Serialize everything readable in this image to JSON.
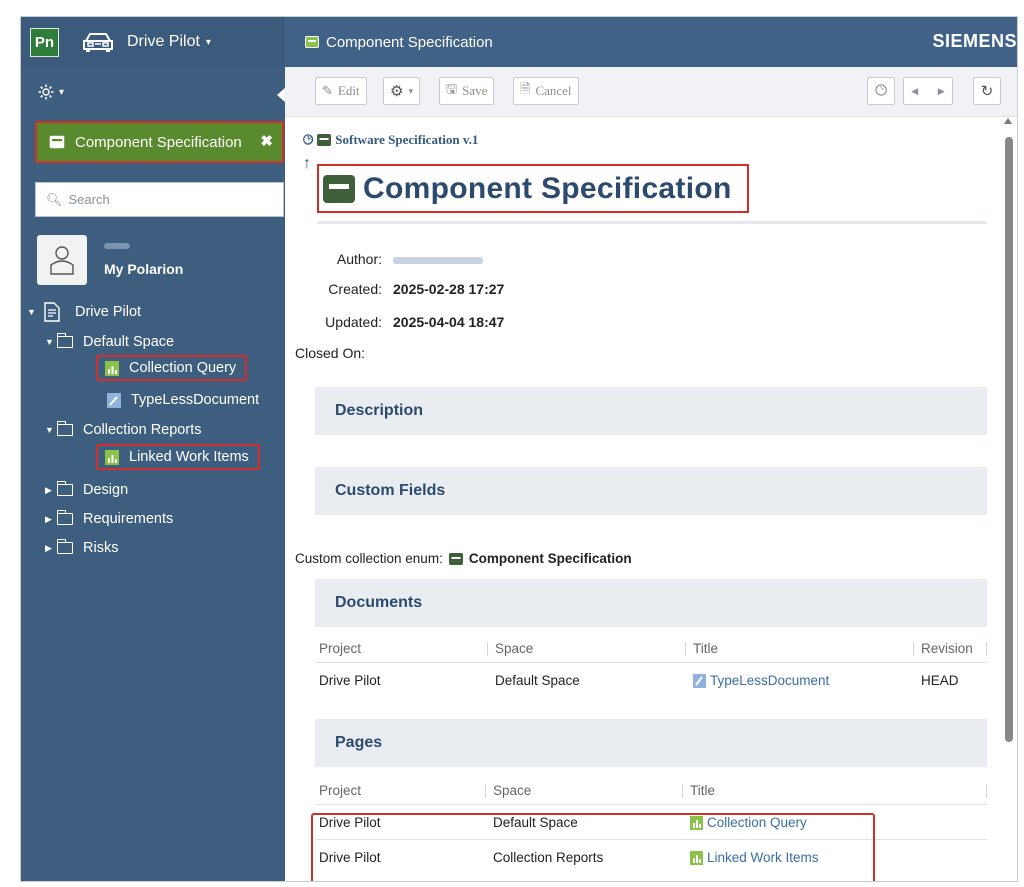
{
  "app": {
    "logo": "Pn",
    "project_name": "Drive Pilot",
    "project_caret": "▾",
    "page_title": "Component Specification",
    "brand": "SIEMENS"
  },
  "sidebar": {
    "collapse_caret": "▾",
    "tag_chip": {
      "label": "Component Specification",
      "close": "✖"
    },
    "search_placeholder": "Search",
    "user": {
      "link": "My Polarion"
    },
    "tree": {
      "root": "Drive Pilot",
      "default_space": "Default Space",
      "collection_query": "Collection Query",
      "typeless_document": "TypeLessDocument",
      "collection_reports": "Collection Reports",
      "linked_work_items": "Linked Work Items",
      "design": "Design",
      "requirements": "Requirements",
      "risks": "Risks"
    }
  },
  "toolbar": {
    "edit": "Edit",
    "save": "Save",
    "cancel": "Cancel"
  },
  "document": {
    "breadcrumb": "Software Specification v.1",
    "title": "Component Specification",
    "fields": {
      "author_label": "Author:",
      "created_label": "Created:",
      "created_value": "2025-02-28 17:27",
      "updated_label": "Updated:",
      "updated_value": "2025-04-04 18:47",
      "closed_label": "Closed On:"
    },
    "sections": {
      "description": "Description",
      "custom_fields": "Custom Fields",
      "documents": "Documents",
      "pages": "Pages"
    },
    "custom_enum": {
      "label": "Custom collection enum:",
      "value": "Component Specification"
    },
    "documents_table": {
      "headers": [
        "Project",
        "Space",
        "Title",
        "Revision"
      ],
      "rows": [
        [
          "Drive Pilot",
          "Default Space",
          "TypeLessDocument",
          "HEAD"
        ]
      ]
    },
    "pages_table": {
      "headers": [
        "Project",
        "Space",
        "Title"
      ],
      "rows": [
        [
          "Drive Pilot",
          "Default Space",
          "Collection Query"
        ],
        [
          "Drive Pilot",
          "Collection Reports",
          "Linked Work Items"
        ]
      ]
    }
  },
  "colors": {
    "topbar": "#3c5b7c",
    "sidebar": "#3e5e7f",
    "chip": "#5a8a2e",
    "highlight": "#d1302a",
    "link": "#3a6ea5"
  }
}
